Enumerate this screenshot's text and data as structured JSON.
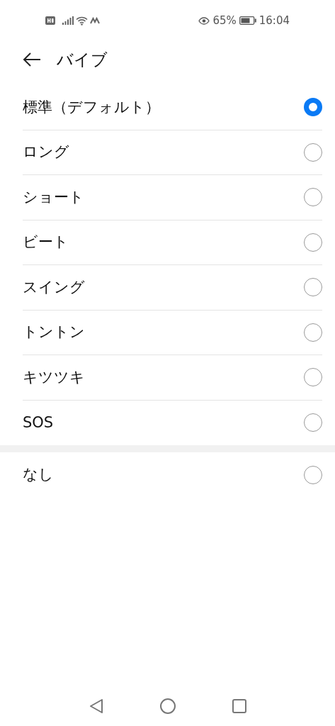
{
  "status_bar": {
    "battery_percent": "65%",
    "time": "16:04"
  },
  "header": {
    "title": "バイブ"
  },
  "sections": [
    {
      "options": [
        {
          "label": "標準（デフォルト）",
          "selected": true
        },
        {
          "label": "ロング",
          "selected": false
        },
        {
          "label": "ショート",
          "selected": false
        },
        {
          "label": "ビート",
          "selected": false
        },
        {
          "label": "スイング",
          "selected": false
        },
        {
          "label": "トントン",
          "selected": false
        },
        {
          "label": "キツツキ",
          "selected": false
        },
        {
          "label": "SOS",
          "selected": false
        }
      ]
    },
    {
      "options": [
        {
          "label": "なし",
          "selected": false
        }
      ]
    }
  ]
}
